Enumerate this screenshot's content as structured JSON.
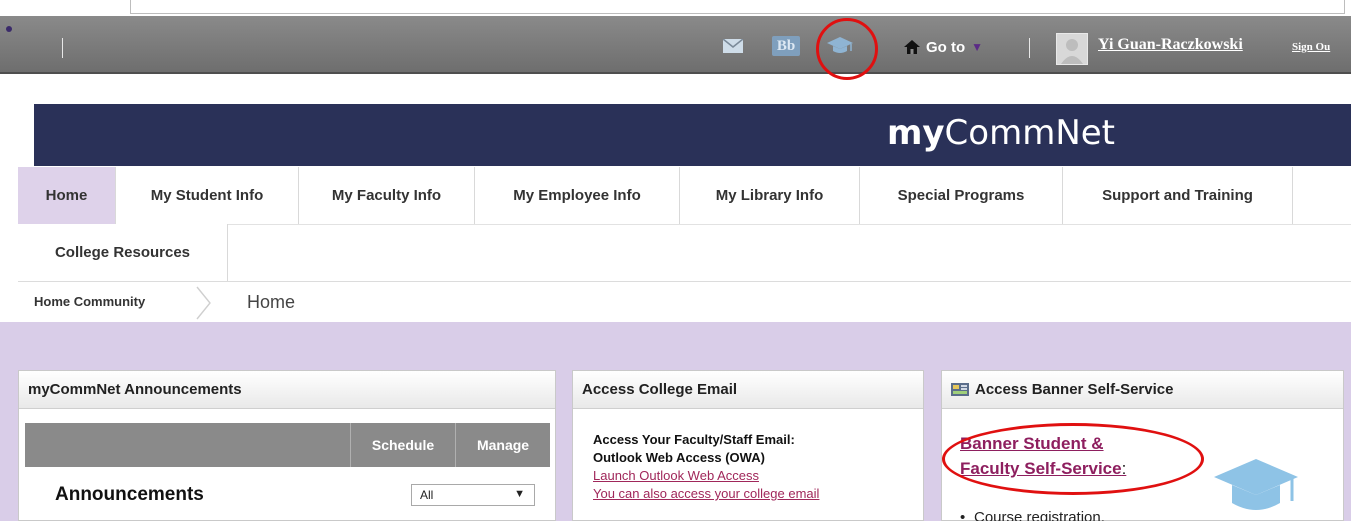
{
  "header": {
    "goto_label": "Go to",
    "user_name": "Yi Guan-Raczkowski",
    "signout_label": "Sign Ou",
    "icons": [
      "mail-icon",
      "blackboard-icon",
      "graduation-cap-icon",
      "home-icon"
    ],
    "bb_label": "Bb"
  },
  "banner": {
    "logo_bold": "my",
    "logo_rest": "CommNet"
  },
  "nav": {
    "items": [
      "Home",
      "My Student Info",
      "My Faculty Info",
      "My Employee Info",
      "My Library Info",
      "Special Programs",
      "Support and Training",
      "College Resources"
    ],
    "active": "Home"
  },
  "breadcrumb": {
    "parent": "Home Community",
    "current": "Home"
  },
  "announcements": {
    "title": "myCommNet Announcements",
    "schedule_label": "Schedule",
    "manage_label": "Manage",
    "heading": "Announcements",
    "filter_value": "All"
  },
  "email": {
    "title": "Access College Email",
    "line1": "Access Your Faculty/Staff Email:",
    "line2": "Outlook Web Access (OWA)",
    "link1": "Launch Outlook Web Access",
    "link2": "You can also access your college email"
  },
  "banner_ss": {
    "title": "Access Banner Self-Service",
    "link_line1": "Banner Student &",
    "link_line2": "Faculty Self-Service",
    "colon": ":",
    "list_item": "Course registration,"
  },
  "colors": {
    "banner_bg": "#2a3158",
    "active_tab": "#ded2ea",
    "content_bg": "#d9cde8",
    "link": "#a0275a",
    "annotation": "#e01010"
  }
}
